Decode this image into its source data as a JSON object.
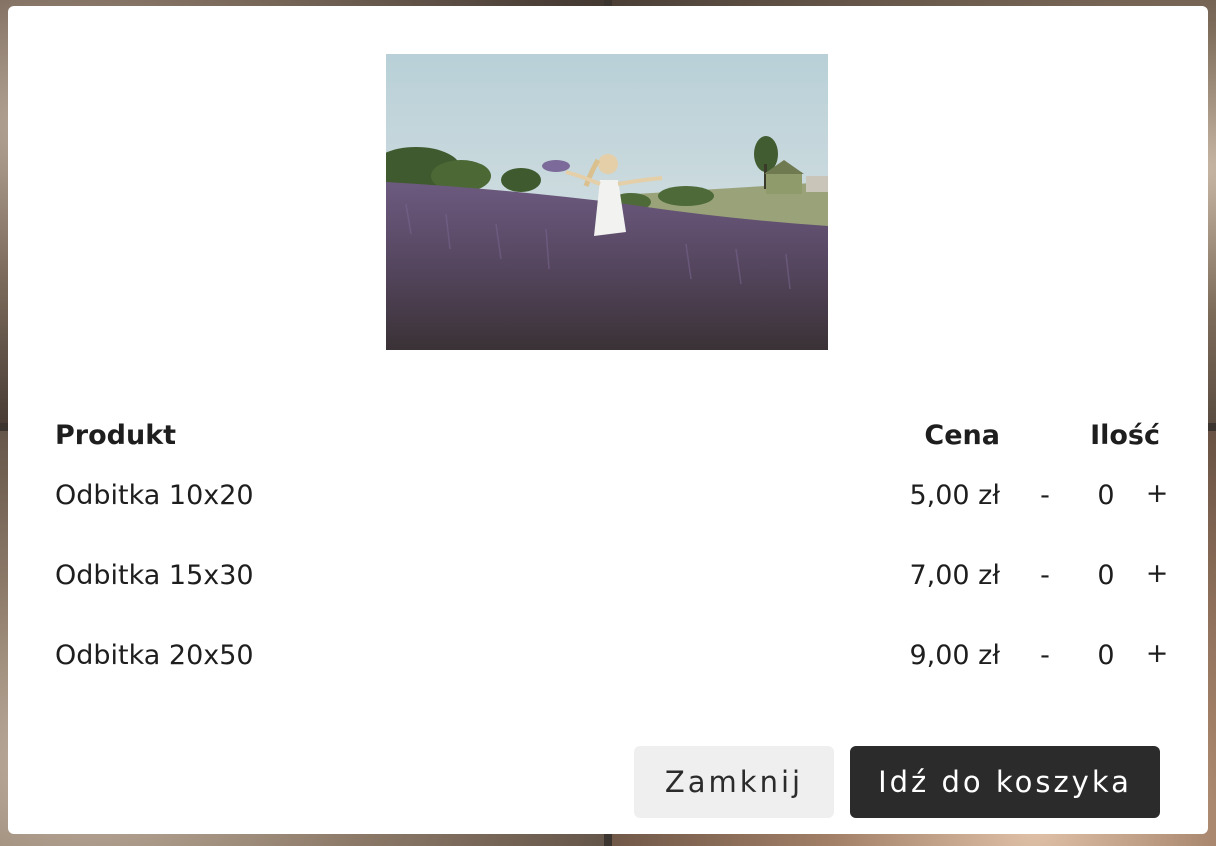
{
  "table": {
    "headers": {
      "product": "Produkt",
      "price": "Cena",
      "quantity": "Ilość"
    },
    "rows": [
      {
        "name": "Odbitka 10x20",
        "price": "5,00 zł",
        "minus": "-",
        "quantity": "0",
        "plus": "+"
      },
      {
        "name": "Odbitka 15x30",
        "price": "7,00 zł",
        "minus": "-",
        "quantity": "0",
        "plus": "+"
      },
      {
        "name": "Odbitka 20x50",
        "price": "9,00 zł",
        "minus": "-",
        "quantity": "0",
        "plus": "+"
      }
    ]
  },
  "buttons": {
    "close_label": "Zamknij",
    "cart_label": "Idź do koszyka"
  },
  "colors": {
    "button_dark": "#2b2b2b",
    "button_light": "#efefef",
    "lavender": "#5e4a6e"
  }
}
